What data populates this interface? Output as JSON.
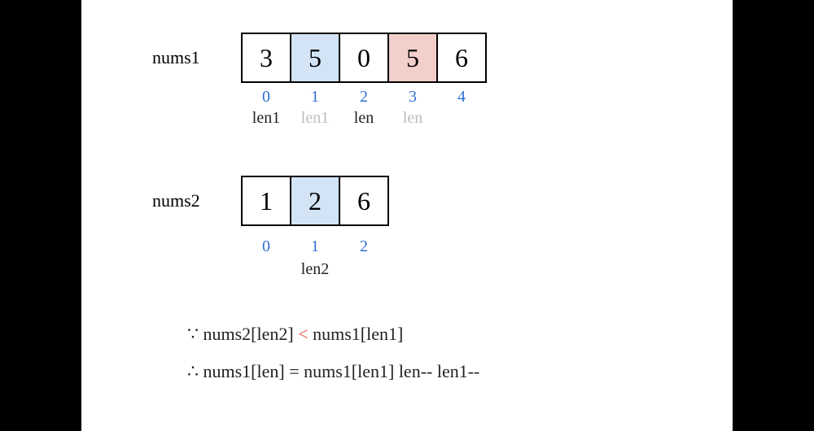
{
  "nums1": {
    "label": "nums1",
    "cells": [
      {
        "value": "3",
        "hl": ""
      },
      {
        "value": "5",
        "hl": "hblue"
      },
      {
        "value": "0",
        "hl": ""
      },
      {
        "value": "5",
        "hl": "hred"
      },
      {
        "value": "6",
        "hl": ""
      }
    ],
    "indices": [
      "0",
      "1",
      "2",
      "3",
      "4"
    ],
    "pointers": [
      {
        "text": "len1",
        "cls": ""
      },
      {
        "text": "len1",
        "cls": "faded"
      },
      {
        "text": "len",
        "cls": ""
      },
      {
        "text": "len",
        "cls": "faded"
      },
      {
        "text": "",
        "cls": ""
      }
    ]
  },
  "nums2": {
    "label": "nums2",
    "cells": [
      {
        "value": "1",
        "hl": ""
      },
      {
        "value": "2",
        "hl": "hblue"
      },
      {
        "value": "6",
        "hl": ""
      }
    ],
    "indices": [
      "0",
      "1",
      "2"
    ],
    "pointers": [
      {
        "text": "",
        "cls": ""
      },
      {
        "text": "len2",
        "cls": ""
      },
      {
        "text": "",
        "cls": ""
      }
    ]
  },
  "expr1": {
    "bc": "∵ ",
    "p1": "nums2[len2] ",
    "lt": "<",
    "p2": " nums1[len1]"
  },
  "expr2": {
    "bc": "∴ ",
    "txt": "nums1[len] = nums1[len1]   len-- len1--"
  }
}
